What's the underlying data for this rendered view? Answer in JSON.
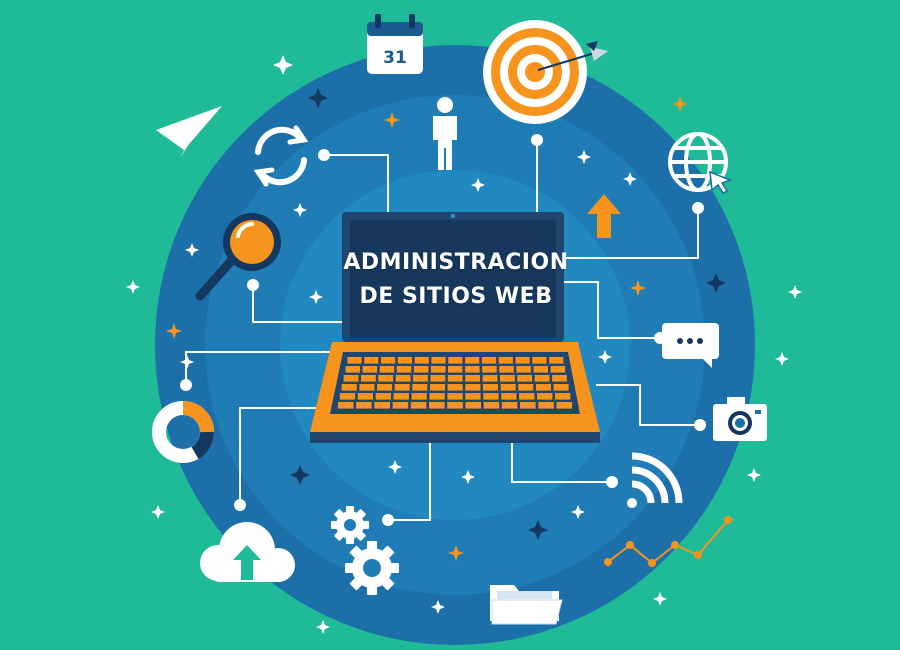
{
  "illustration": {
    "title_line_1": "ADMINISTRACION",
    "title_line_2": "DE SITIOS WEB",
    "calendar_day": "31"
  },
  "colors": {
    "background": "#1fba97",
    "circle_outer": "#1c6fa8",
    "circle_mid": "#1f82bb",
    "circle_inner": "#2391c8",
    "accent_orange": "#f7941d",
    "laptop_dark": "#20466f",
    "icon_white": "#ffffff",
    "connector": "#ffffff"
  },
  "icons": [
    "calendar-icon",
    "target-icon",
    "person-icon",
    "paper-plane-icon",
    "sync-icon",
    "globe-cursor-icon",
    "up-arrow-icon",
    "magnifier-icon",
    "chat-bubble-icon",
    "donut-chart-icon",
    "camera-icon",
    "wifi-icon",
    "gears-icon",
    "cloud-upload-icon",
    "folder-icon",
    "line-graph-icon",
    "laptop-icon"
  ]
}
